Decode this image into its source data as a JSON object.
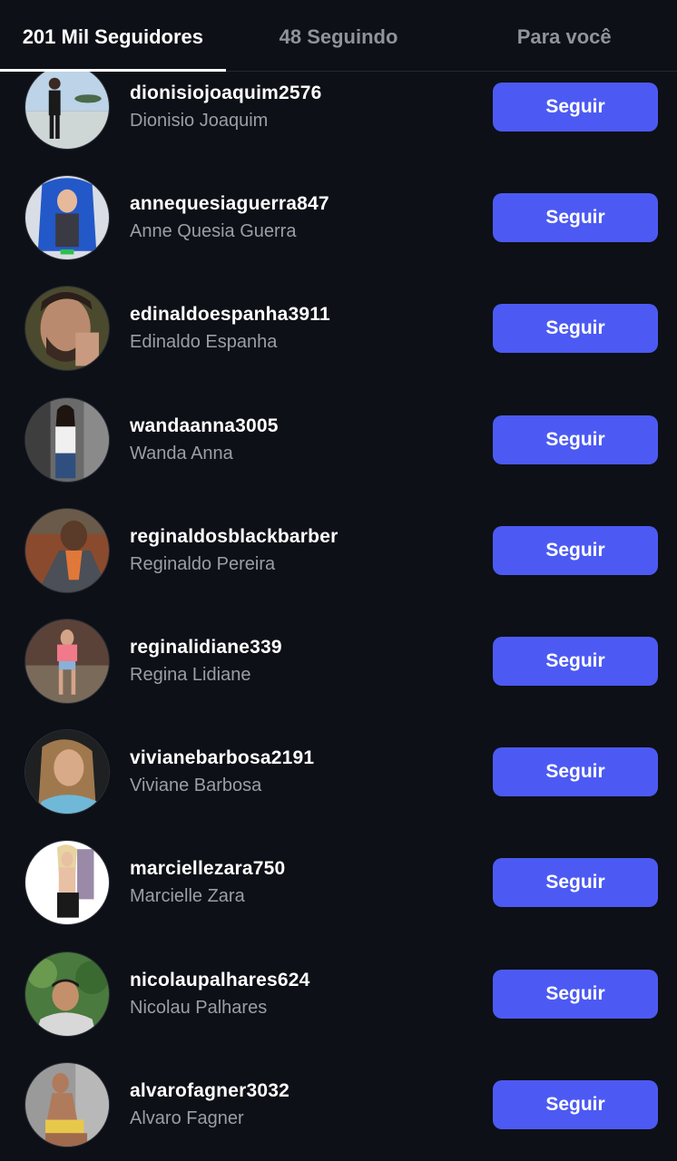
{
  "tabs": [
    {
      "label": "201 Mil Seguidores",
      "active": true
    },
    {
      "label": "48 Seguindo",
      "active": false
    },
    {
      "label": "Para você",
      "active": false
    }
  ],
  "follow_label": "Seguir",
  "colors": {
    "background": "#0d1016",
    "button": "#4c5af3",
    "username": "#ffffff",
    "fullname": "#9a9ea6",
    "tab_inactive": "#8e939c"
  },
  "users": [
    {
      "username": "dionisiojoaquim2576",
      "fullname": "Dionisio Joaquim",
      "button": "Seguir"
    },
    {
      "username": "annequesiaguerra847",
      "fullname": "Anne Quesia Guerra",
      "button": "Seguir"
    },
    {
      "username": "edinaldoespanha3911",
      "fullname": "Edinaldo Espanha",
      "button": "Seguir"
    },
    {
      "username": "wandaanna3005",
      "fullname": "Wanda Anna",
      "button": "Seguir"
    },
    {
      "username": "reginaldosblackbarber",
      "fullname": "Reginaldo Pereira",
      "button": "Seguir"
    },
    {
      "username": "reginalidiane339",
      "fullname": "Regina Lidiane",
      "button": "Seguir"
    },
    {
      "username": "vivianebarbosa2191",
      "fullname": "Viviane Barbosa",
      "button": "Seguir"
    },
    {
      "username": "marciellezara750",
      "fullname": "Marcielle Zara",
      "button": "Seguir"
    },
    {
      "username": "nicolaupalhares624",
      "fullname": "Nicolau Palhares",
      "button": "Seguir"
    },
    {
      "username": "alvarofagner3032",
      "fullname": "Alvaro Fagner",
      "button": "Seguir"
    }
  ]
}
